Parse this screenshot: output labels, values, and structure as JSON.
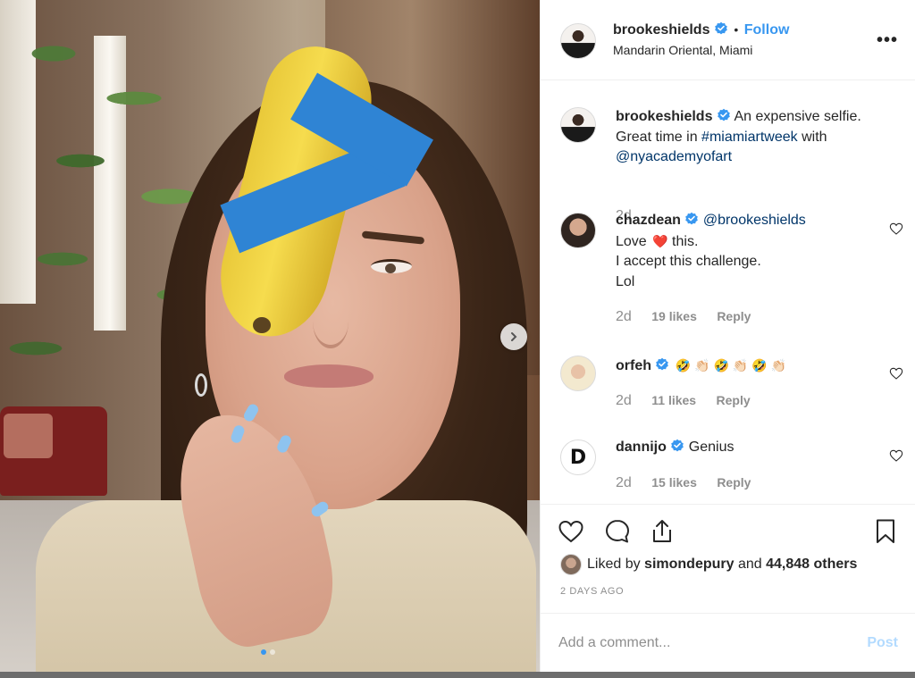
{
  "post": {
    "author": "brookeshields",
    "location": "Mandarin Oriental, Miami",
    "follow_label": "Follow",
    "separator": "•",
    "more_label": "•••",
    "caption": {
      "username": "brookeshields",
      "text_1": "An expensive selfie.",
      "text_2": "Great time in",
      "hashtag": "#miamiartweek",
      "text_3": "with",
      "mention": "@nyacademyofart",
      "time": "2d"
    },
    "image": {
      "slide_count": 2,
      "active_slide": 1
    }
  },
  "comments": [
    {
      "username": "chazdean",
      "mention": "@brookeshields",
      "line_1_pre": "Love",
      "heart": "❤️",
      "line_1_post": "this.",
      "line_2": "I accept this challenge.",
      "line_3": "Lol",
      "time": "2d",
      "likes": "19 likes",
      "reply": "Reply"
    },
    {
      "username": "orfeh",
      "emojis": "🤣 👏🏻 🤣 👏🏻 🤣 👏🏻",
      "time": "2d",
      "likes": "11 likes",
      "reply": "Reply"
    },
    {
      "username": "dannijo",
      "text": "Genius",
      "avatar_letter": "D",
      "time": "2d",
      "likes": "15 likes",
      "reply": "Reply"
    }
  ],
  "likes": {
    "prefix": "Liked by",
    "user": "simondepury",
    "and": "and",
    "others": "44,848 others"
  },
  "timestamp": "2 DAYS AGO",
  "add_comment": {
    "placeholder": "Add a comment...",
    "post_label": "Post"
  },
  "colors": {
    "link": "#003569",
    "accent": "#3897f0",
    "muted": "#8e8e8e",
    "post_disabled": "#b3dbff",
    "verified": "#3897f0"
  }
}
